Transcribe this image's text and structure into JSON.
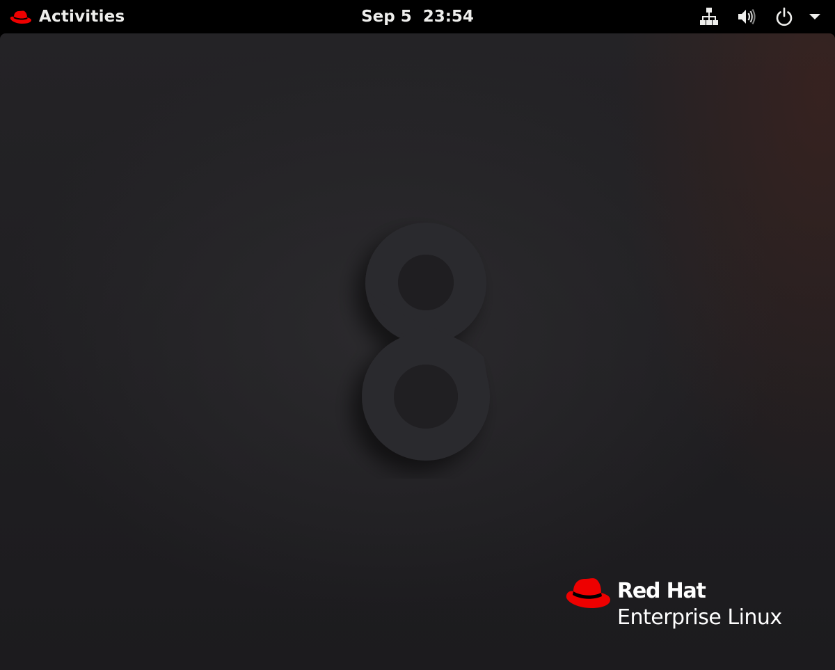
{
  "topbar": {
    "activities_label": "Activities",
    "activities_icon": "redhat-hat-icon",
    "date": "Sep 5",
    "time": "23:54",
    "tray_icons": [
      "network-wired-icon",
      "volume-icon",
      "power-icon",
      "chevron-down-icon"
    ]
  },
  "desktop": {
    "wallpaper_figure": "8",
    "brand": {
      "line1": "Red Hat",
      "line2": "Enterprise Linux",
      "logo_icon": "redhat-hat-icon"
    }
  },
  "colors": {
    "topbar_bg": "#000000",
    "topbar_text": "#eeeeec",
    "brand_red": "#ee0000",
    "wallpaper": "#222124",
    "figure": "#2a292c"
  }
}
